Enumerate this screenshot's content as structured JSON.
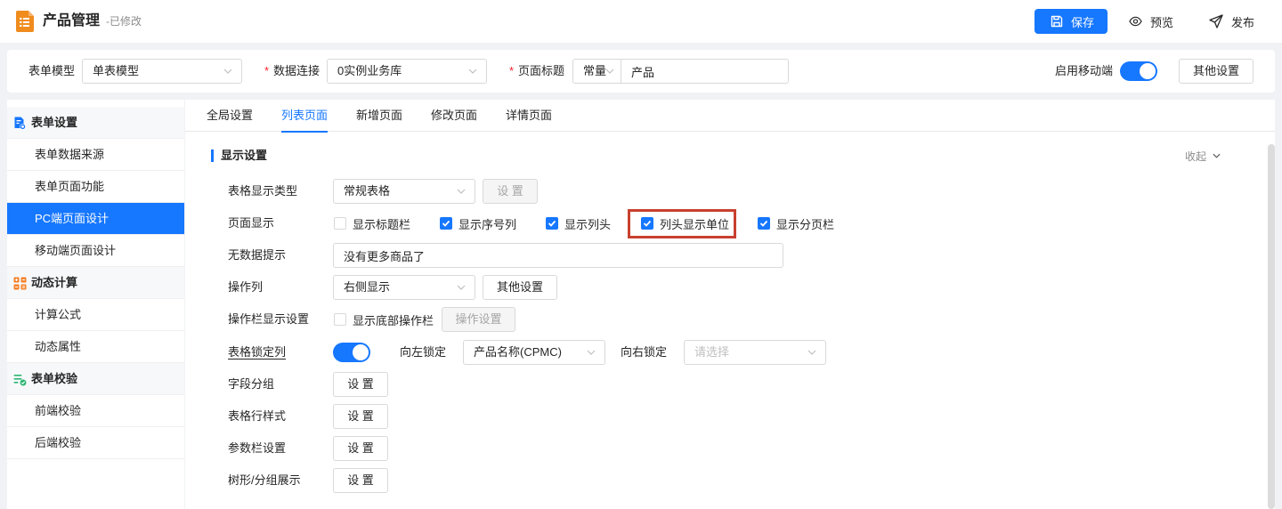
{
  "colors": {
    "primary": "#1677ff",
    "highlight": "#c8402e",
    "required": "#f5222d",
    "logo": "#f08c1e"
  },
  "header": {
    "logo_icon": "form-document-icon",
    "title": "产品管理",
    "status": "-已修改",
    "save": {
      "icon": "save-icon",
      "label": "保存"
    },
    "preview": {
      "icon": "eye-icon",
      "label": "预览"
    },
    "publish": {
      "icon": "send-icon",
      "label": "发布"
    }
  },
  "config_bar": {
    "form_model": {
      "label": "表单模型",
      "value": "单表模型"
    },
    "data_connection": {
      "required_mark": "*",
      "label": "数据连接",
      "value": "0实例业务库"
    },
    "page_title": {
      "required_mark": "*",
      "label": "页面标题",
      "mode": "常量",
      "value": "产品"
    },
    "mobile": {
      "label": "启用移动端",
      "enabled": true
    },
    "other_settings": "其他设置"
  },
  "sidebar": {
    "groups": [
      {
        "label": "表单设置",
        "icon": "form-settings-icon",
        "items": [
          {
            "label": "表单数据来源",
            "active": false
          },
          {
            "label": "表单页面功能",
            "active": false
          },
          {
            "label": "PC端页面设计",
            "active": true
          },
          {
            "label": "移动端页面设计",
            "active": false
          }
        ]
      },
      {
        "label": "动态计算",
        "icon": "calc-grid-icon",
        "items": [
          {
            "label": "计算公式",
            "active": false
          },
          {
            "label": "动态属性",
            "active": false
          }
        ]
      },
      {
        "label": "表单校验",
        "icon": "checklist-icon",
        "items": [
          {
            "label": "前端校验",
            "active": false
          },
          {
            "label": "后端校验",
            "active": false
          }
        ]
      }
    ]
  },
  "tabs": [
    {
      "label": "全局设置",
      "active": false
    },
    {
      "label": "列表页面",
      "active": true
    },
    {
      "label": "新增页面",
      "active": false
    },
    {
      "label": "修改页面",
      "active": false
    },
    {
      "label": "详情页面",
      "active": false
    }
  ],
  "display_settings": {
    "title": "显示设置",
    "collapse_label": "收起",
    "table_type": {
      "label": "表格显示类型",
      "value": "常规表格",
      "button": "设 置",
      "button_disabled": true
    },
    "page_display": {
      "label": "页面显示",
      "options": [
        {
          "label": "显示标题栏",
          "checked": false
        },
        {
          "label": "显示序号列",
          "checked": true
        },
        {
          "label": "显示列头",
          "checked": true
        },
        {
          "label": "列头显示单位",
          "checked": true,
          "highlighted": true
        },
        {
          "label": "显示分页栏",
          "checked": true
        }
      ]
    },
    "empty_hint": {
      "label": "无数据提示",
      "value": "没有更多商品了"
    },
    "action_column": {
      "label": "操作列",
      "value": "右侧显示",
      "button": "其他设置"
    },
    "action_bar": {
      "label": "操作栏显示设置",
      "option": {
        "label": "显示底部操作栏",
        "checked": false
      },
      "button": "操作设置",
      "button_disabled": true
    },
    "lock_columns": {
      "label": "表格锁定列",
      "enabled": true,
      "left_label": "向左锁定",
      "left_value": "产品名称(CPMC)",
      "right_label": "向右锁定",
      "right_placeholder": "请选择"
    },
    "field_group": {
      "label": "字段分组",
      "button": "设 置"
    },
    "row_style": {
      "label": "表格行样式",
      "button": "设 置"
    },
    "param_bar": {
      "label": "参数栏设置",
      "button": "设 置"
    },
    "tree_group": {
      "label": "树形/分组展示",
      "button": "设 置"
    }
  }
}
